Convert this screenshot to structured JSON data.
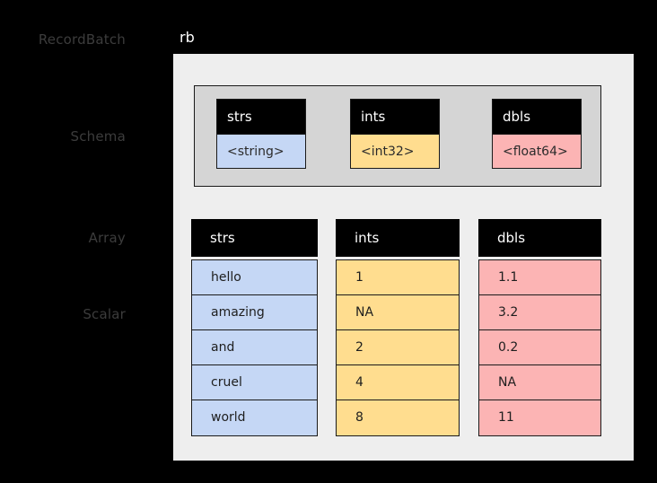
{
  "diagram": {
    "side_labels": [
      {
        "text": "RecordBatch"
      },
      {
        "text": "Schema"
      },
      {
        "text": "Array"
      },
      {
        "text": "Scalar"
      }
    ],
    "recordbatch": {
      "title": "rb"
    },
    "schema": {
      "fields": [
        {
          "name": "strs",
          "type": "<string>",
          "color": "#c5d7f5"
        },
        {
          "name": "ints",
          "type": "<int32>",
          "color": "#ffdd8f"
        },
        {
          "name": "dbls",
          "type": "<float64>",
          "color": "#fcb4b4"
        }
      ]
    },
    "arrays": [
      {
        "name": "strs",
        "color": "#c5d7f5",
        "values": [
          "hello",
          "amazing",
          "and",
          "cruel",
          "world"
        ]
      },
      {
        "name": "ints",
        "color": "#ffdd8f",
        "values": [
          "1",
          "NA",
          "2",
          "4",
          "8"
        ]
      },
      {
        "name": "dbls",
        "color": "#fcb4b4",
        "values": [
          "1.1",
          "3.2",
          "0.2",
          "NA",
          "11"
        ]
      }
    ],
    "colors": {
      "background": "#000000",
      "recordbatch_fill": "#eeeeee",
      "schema_fill": "#d5d5d5",
      "header_fill": "#000000",
      "label_text": "#3c3c3c",
      "title_text": "#ffffff"
    }
  }
}
